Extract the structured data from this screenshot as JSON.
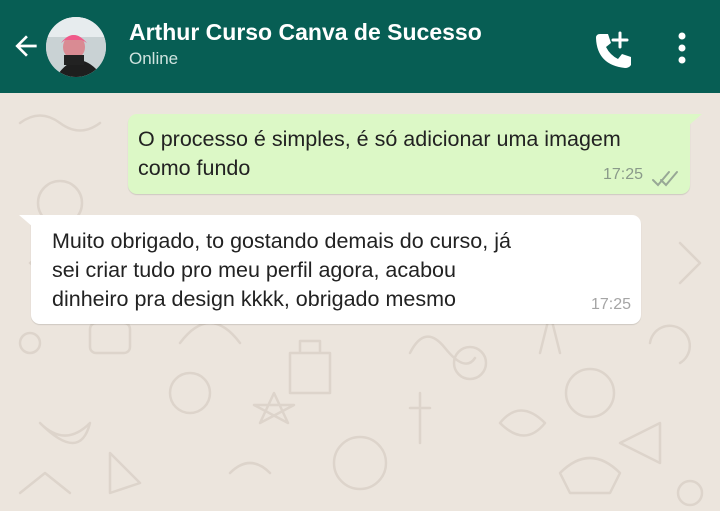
{
  "header": {
    "contact_name": "Arthur Curso Canva de Sucesso",
    "status": "Online",
    "background": "#075e54"
  },
  "icons": {
    "back": "arrow-left-icon",
    "avatar": "contact-avatar",
    "call": "add-call-icon",
    "menu": "more-vert-icon",
    "read": "double-check-icon"
  },
  "messages": [
    {
      "direction": "outgoing",
      "text": "O processo é simples, é só adicionar uma imagem\ncomo fundo",
      "time": "17:25",
      "status": "read"
    },
    {
      "direction": "incoming",
      "text": "Muito obrigado, to gostando demais do curso, já\nsei criar tudo pro meu perfil agora, acabou\ndinheiro pra design kkkk, obrigado mesmo",
      "time": "17:25"
    }
  ],
  "colors": {
    "chat_background": "#ece5dd",
    "outgoing_bubble": "#dcf8c6",
    "incoming_bubble": "#ffffff"
  }
}
